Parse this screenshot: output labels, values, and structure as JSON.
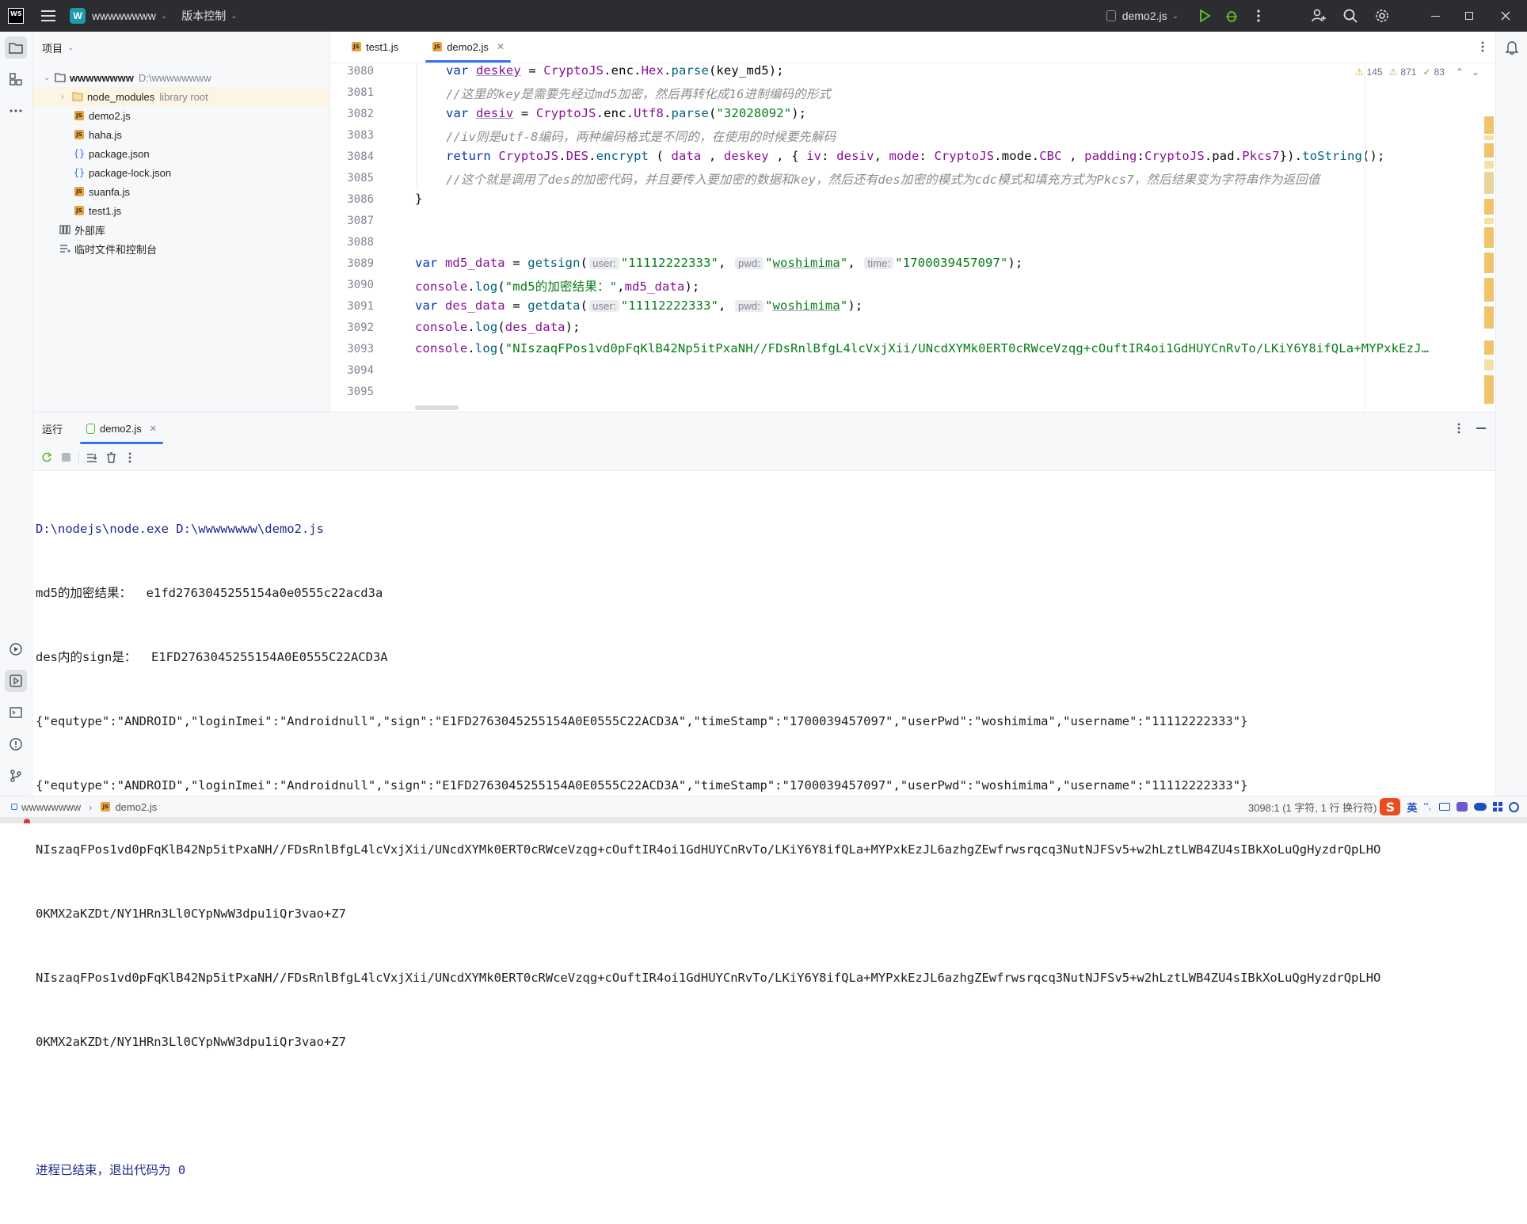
{
  "titlebar": {
    "ws_logo": "WS",
    "project_badge": "W",
    "project_name": "wwwwwwww",
    "vcs_label": "版本控制",
    "run_config": "demo2.js"
  },
  "project_panel": {
    "title": "项目",
    "root_name": "wwwwwwww",
    "root_path": "D:\\wwwwwwww",
    "items": [
      {
        "label": "node_modules",
        "extra": "library root",
        "kind": "folder"
      },
      {
        "label": "demo2.js",
        "kind": "js"
      },
      {
        "label": "haha.js",
        "kind": "js"
      },
      {
        "label": "package.json",
        "kind": "json"
      },
      {
        "label": "package-lock.json",
        "kind": "json"
      },
      {
        "label": "suanfa.js",
        "kind": "js"
      },
      {
        "label": "test1.js",
        "kind": "js"
      }
    ],
    "external_libs": "外部库",
    "scratches": "临时文件和控制台"
  },
  "editor": {
    "tabs": [
      {
        "label": "test1.js",
        "active": false
      },
      {
        "label": "demo2.js",
        "active": true
      }
    ],
    "inspections": {
      "warnings": "145",
      "weak_warnings": "871",
      "ok": "83"
    },
    "line_numbers": [
      "3080",
      "3081",
      "3082",
      "3083",
      "3084",
      "3085",
      "3086",
      "3087",
      "3088",
      "3089",
      "3090",
      "3091",
      "3092",
      "3093",
      "3094",
      "3095"
    ],
    "code": {
      "l3080_kw": "var ",
      "l3080_var": "deskey",
      "l3080_rest1": " = ",
      "l3080_obj": "CryptoJS",
      "l3080_rest2": ".enc.",
      "l3080_obj2": "Hex",
      "l3080_rest3": ".",
      "l3080_fn": "parse",
      "l3080_rest4": "(key_md5);",
      "l3081": "//这里的key是需要先经过md5加密，然后再转化成16进制编码的形式",
      "l3082_kw": "var ",
      "l3082_var": "desiv",
      "l3082_rest1": " = ",
      "l3082_obj": "CryptoJS",
      "l3082_rest2": ".enc.",
      "l3082_obj2": "Utf8",
      "l3082_rest3": ".",
      "l3082_fn": "parse",
      "l3082_rest4": "(",
      "l3082_str": "\"32028092\"",
      "l3082_rest5": ");",
      "l3083": "//iv则是utf-8编码，两种编码格式是不同的，在使用的时候要先解码",
      "l3084_kw": "return ",
      "l3084_obj": "CryptoJS",
      "l3084_rest1": ".",
      "l3084_obj2": "DES",
      "l3084_rest2": ".",
      "l3084_fn": "encrypt",
      "l3084_rest3": " ( ",
      "l3084_a1": "data",
      "l3084_rest4": " , ",
      "l3084_a2": "deskey",
      "l3084_rest5": " , { ",
      "l3084_k1": "iv",
      "l3084_rest6": ": ",
      "l3084_a3": "desiv",
      "l3084_rest7": ", ",
      "l3084_k2": "mode",
      "l3084_rest8": ": ",
      "l3084_obj3": "CryptoJS",
      "l3084_rest9": ".mode.",
      "l3084_obj4": "CBC",
      "l3084_rest10": " , ",
      "l3084_k3": "padding",
      "l3084_rest11": ":",
      "l3084_obj5": "CryptoJS",
      "l3084_rest12": ".pad.",
      "l3084_obj6": "Pkcs7",
      "l3084_rest13": "}).",
      "l3084_fn2": "toString",
      "l3084_rest14": "();",
      "l3085": "//这个就是调用了des的加密代码，并且要传入要加密的数据和key，然后还有des加密的模式为cdc模式和填充方式为Pkcs7，然后结果变为字符串作为返回值",
      "l3086": "}",
      "l3089_kw": "var ",
      "l3089_var": "md5_data",
      "l3089_rest1": " = ",
      "l3089_fn": "getsign",
      "l3089_rest2": "(",
      "l3089_h1": "user:",
      "l3089_s1": "\"11112222333\"",
      "l3089_rest3": ", ",
      "l3089_h2": "pwd:",
      "l3089_s2a": "\"",
      "l3089_s2b": "woshimima",
      "l3089_s2c": "\"",
      "l3089_rest4": ", ",
      "l3089_h3": "time:",
      "l3089_s3": "\"1700039457097\"",
      "l3089_rest5": ");",
      "l3090_obj": "console",
      "l3090_rest1": ".",
      "l3090_fn": "log",
      "l3090_rest2": "(",
      "l3090_str": "\"md5的加密结果：\"",
      "l3090_rest3": ",",
      "l3090_var": "md5_data",
      "l3090_rest4": ");",
      "l3091_kw": "var ",
      "l3091_var": "des_data",
      "l3091_rest1": " = ",
      "l3091_fn": "getdata",
      "l3091_rest2": "(",
      "l3091_h1": "user:",
      "l3091_s1": "\"11112222333\"",
      "l3091_rest3": ", ",
      "l3091_h2": "pwd:",
      "l3091_s2a": "\"",
      "l3091_s2b": "woshimima",
      "l3091_s2c": "\"",
      "l3091_rest4": ");",
      "l3092_obj": "console",
      "l3092_rest1": ".",
      "l3092_fn": "log",
      "l3092_rest2": "(",
      "l3092_var": "des_data",
      "l3092_rest3": ");",
      "l3093_obj": "console",
      "l3093_rest1": ".",
      "l3093_fn": "log",
      "l3093_rest2": "(",
      "l3093_str": "\"NIszaqFPos1vd0pFqKlB42Np5itPxaNH//FDsRnlBfgL4lcVxjXii/UNcdXYMk0ERT0cRWceVzqg+cOuftIR4oi1GdHUYCnRvTo/LKiY6Y8ifQLa+MYPxkEzJ…"
    }
  },
  "run_panel": {
    "title": "运行",
    "tab_label": "demo2.js",
    "console_lines": [
      "D:\\nodejs\\node.exe D:\\wwwwwwww\\demo2.js",
      "md5的加密结果：  e1fd2763045255154a0e0555c22acd3a",
      "des内的sign是：  E1FD2763045255154A0E0555C22ACD3A",
      "{\"equtype\":\"ANDROID\",\"loginImei\":\"Androidnull\",\"sign\":\"E1FD2763045255154A0E0555C22ACD3A\",\"timeStamp\":\"1700039457097\",\"userPwd\":\"woshimima\",\"username\":\"11112222333\"}",
      "{\"equtype\":\"ANDROID\",\"loginImei\":\"Androidnull\",\"sign\":\"E1FD2763045255154A0E0555C22ACD3A\",\"timeStamp\":\"1700039457097\",\"userPwd\":\"woshimima\",\"username\":\"11112222333\"}",
      "NIszaqFPos1vd0pFqKlB42Np5itPxaNH//FDsRnlBfgL4lcVxjXii/UNcdXYMk0ERT0cRWceVzqg+cOuftIR4oi1GdHUYCnRvTo/LKiY6Y8ifQLa+MYPxkEzJL6azhgZEwfrwsrqcq3NutNJFSv5+w2hLztLWB4ZU4sIBkXoLuQgHyzdrQpLHO",
      "0KMX2aKZDt/NY1HRn3Ll0CYpNwW3dpu1iQr3vao+Z7",
      "NIszaqFPos1vd0pFqKlB42Np5itPxaNH//FDsRnlBfgL4lcVxjXii/UNcdXYMk0ERT0cRWceVzqg+cOuftIR4oi1GdHUYCnRvTo/LKiY6Y8ifQLa+MYPxkEzJL6azhgZEwfrwsrqcq3NutNJFSv5+w2hLztLWB4ZU4sIBkXoLuQgHyzdrQpLHO",
      "0KMX2aKZDt/NY1HRn3Ll0CYpNwW3dpu1iQr3vao+Z7",
      "",
      "进程已结束，退出代码为 0"
    ]
  },
  "statusbar": {
    "breadcrumb_project": "wwwwwwww",
    "breadcrumb_file": "demo2.js",
    "position": "3098:1 (1 字符, 1 行 换行符)",
    "ime_lang": "英",
    "ime_punct": "'°,"
  },
  "colors": {
    "accent": "#3574f0",
    "run_green": "#5fb832",
    "js_badge": "#e8a33d",
    "titlebar_bg": "#2b2d30"
  }
}
